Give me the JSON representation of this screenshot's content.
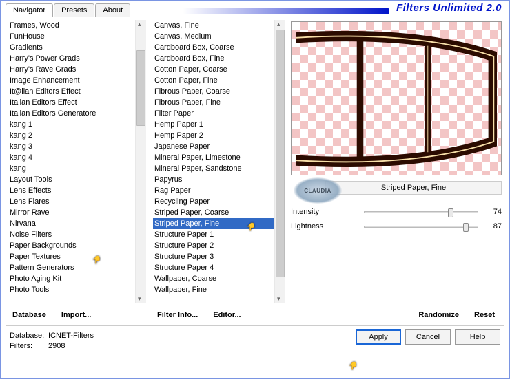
{
  "brand": "Filters Unlimited 2.0",
  "tabs": {
    "navigator": "Navigator",
    "presets": "Presets",
    "about": "About",
    "active": "Navigator"
  },
  "categories": [
    "Frames, Wood",
    "FunHouse",
    "Gradients",
    "Harry's Power Grads",
    "Harry's Rave Grads",
    "Image Enhancement",
    "It@lian Editors Effect",
    "Italian Editors Effect",
    "Italian Editors Generatore",
    "kang 1",
    "kang 2",
    "kang 3",
    "kang 4",
    "kang",
    "Layout Tools",
    "Lens Effects",
    "Lens Flares",
    "Mirror Rave",
    "Nirvana",
    "Noise Filters",
    "Paper Backgrounds",
    "Paper Textures",
    "Pattern Generators",
    "Photo Aging Kit",
    "Photo Tools"
  ],
  "category_selected": "Paper Textures",
  "filters": [
    "Canvas, Fine",
    "Canvas, Medium",
    "Cardboard Box, Coarse",
    "Cardboard Box, Fine",
    "Cotton Paper, Coarse",
    "Cotton Paper, Fine",
    "Fibrous Paper, Coarse",
    "Fibrous Paper, Fine",
    "Filter Paper",
    "Hemp Paper 1",
    "Hemp Paper 2",
    "Japanese Paper",
    "Mineral Paper, Limestone",
    "Mineral Paper, Sandstone",
    "Papyrus",
    "Rag Paper",
    "Recycling Paper",
    "Striped Paper, Coarse",
    "Striped Paper, Fine",
    "Structure Paper 1",
    "Structure Paper 2",
    "Structure Paper 3",
    "Structure Paper 4",
    "Wallpaper, Coarse",
    "Wallpaper, Fine"
  ],
  "filter_selected": "Striped Paper, Fine",
  "midbuttons": {
    "database": "Database",
    "import": "Import...",
    "filterinfo": "Filter Info...",
    "editor": "Editor...",
    "randomize": "Randomize",
    "reset": "Reset"
  },
  "current_filter_label": "Striped Paper, Fine",
  "params": [
    {
      "name": "Intensity",
      "value": 74
    },
    {
      "name": "Lightness",
      "value": 87
    }
  ],
  "status": {
    "db_label": "Database:",
    "db_val": "ICNET-Filters",
    "filters_label": "Filters:",
    "filters_val": "2908"
  },
  "buttons": {
    "apply": "Apply",
    "cancel": "Cancel",
    "help": "Help"
  },
  "watermark": "CLAUDIA"
}
